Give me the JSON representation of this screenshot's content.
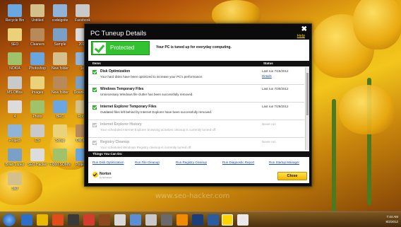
{
  "dialog": {
    "title": "PC Tuneup Details",
    "close_glyph": "✖",
    "help": "Help",
    "protected_label": "Protected",
    "status_message": "Your PC is tuned up for everyday computing.",
    "columns": {
      "items": "Items",
      "status": "Status"
    },
    "rows": [
      {
        "title": "Disk Optimization",
        "desc": "Your hard disks have been optimized to increase your PC's performance.",
        "status": "Last run 7/15/2012",
        "details": "Details",
        "checked": true
      },
      {
        "title": "Windows Temporary Files",
        "desc": "Unnecessary Windows file clutter has been successfully removed.",
        "status": "Last run 7/30/2012",
        "checked": true
      },
      {
        "title": "Internet Explorer Temporary Files",
        "desc": "Outdated files left behind by Internet Explorer have been successfully removed.",
        "status": "Last run 7/29/2012",
        "checked": true
      },
      {
        "title": "Internet Explorer History",
        "desc": "Your scheduled Internet Explorer browsing activities cleanup is currently turned off.",
        "status": "Never run",
        "checked": false
      },
      {
        "title": "Registry Cleanup",
        "desc": "Your scheduled Windows Registry cleanup is currently turned off.",
        "status": "Never run",
        "checked": false
      }
    ],
    "things_header": "Things You Can Do:",
    "links": [
      "Run Disk Optimization",
      "Run File Cleanup",
      "Run Registry Cleanup",
      "Run Diagnostic Report",
      "Run Startup Manager"
    ],
    "norton": "Norton",
    "norton_sub": "by Symantec",
    "close_button": "Close"
  },
  "desktop": {
    "icons": [
      "Recycle Bin",
      "Untitled",
      "codeignite",
      "Facebook",
      "SEO",
      "Cleaners",
      "Sample",
      "2012",
      "NOKIA",
      "Photoshop",
      "New folder",
      "1st",
      "MS Office",
      "Images",
      "New folder",
      "Downloads",
      "4",
      "Photo",
      "BRC",
      "Roots",
      "Project",
      "CS",
      "Scrap",
      "Old stuff",
      "Brian Lopez",
      "SEO Hacker",
      "FI300 SOMN",
      "Project 2",
      "360"
    ]
  },
  "taskbar": {
    "time": "7:44 AM",
    "date": "8/2/2012",
    "watermark": "www.seo-hacker.com"
  },
  "colors": {
    "protected": "#32c12f",
    "accent": "#ffd400",
    "link": "#1a4fb5"
  }
}
